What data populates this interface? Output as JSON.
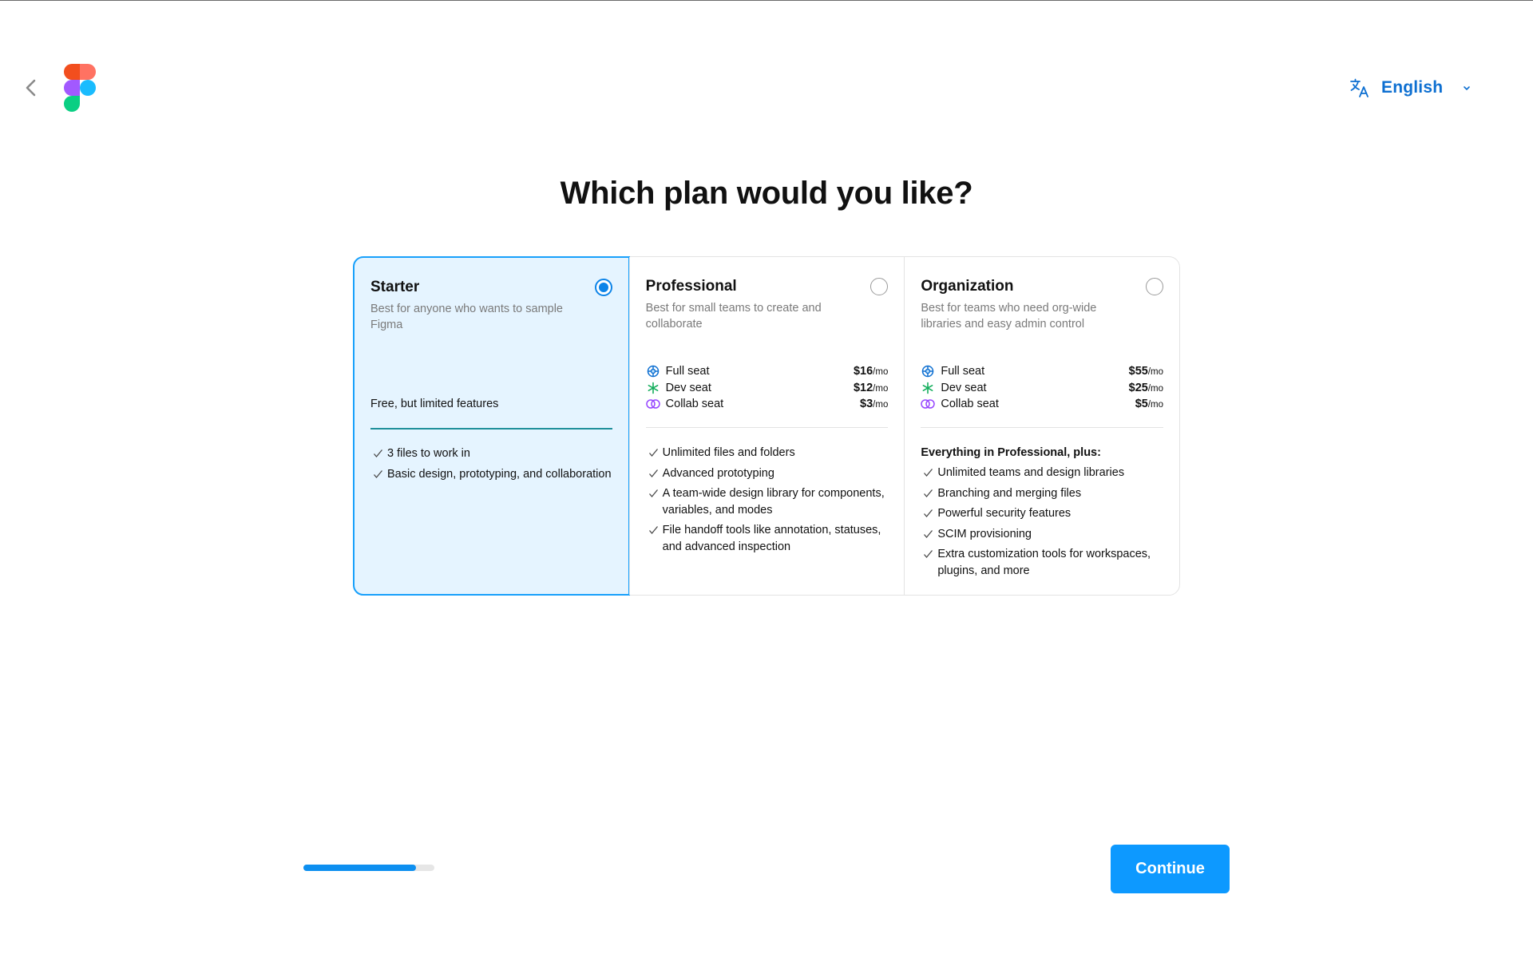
{
  "header": {
    "back_icon": "chevron-left-icon",
    "logo": "figma-logo",
    "language": {
      "icon": "translate-icon",
      "label": "English",
      "caret_icon": "chevron-down-icon"
    }
  },
  "title": "Which plan would you like?",
  "colors": {
    "accent": "#0d99ff",
    "selected_bg": "#e5f4ff",
    "link_blue": "#0d6fd1"
  },
  "plans": [
    {
      "name": "Starter",
      "description": "Best for anyone who wants to sample Figma",
      "selected": true,
      "note": "Free, but limited features",
      "features": [
        "3 files to work in",
        "Basic design, prototyping, and collaboration"
      ]
    },
    {
      "name": "Professional",
      "description": "Best for small teams to create and collaborate",
      "selected": false,
      "seats": [
        {
          "icon": "full-seat-icon",
          "name": "Full seat",
          "price": "$16",
          "per": "/mo"
        },
        {
          "icon": "dev-seat-icon",
          "name": "Dev seat",
          "price": "$12",
          "per": "/mo"
        },
        {
          "icon": "collab-seat-icon",
          "name": "Collab seat",
          "price": "$3",
          "per": "/mo"
        }
      ],
      "features": [
        "Unlimited files and folders",
        "Advanced prototyping",
        "A team-wide design library for components, variables, and modes",
        "File handoff tools like annotation, statuses, and advanced inspection"
      ]
    },
    {
      "name": "Organization",
      "description": "Best for teams who need org-wide libraries and easy admin control",
      "selected": false,
      "seats": [
        {
          "icon": "full-seat-icon",
          "name": "Full seat",
          "price": "$55",
          "per": "/mo"
        },
        {
          "icon": "dev-seat-icon",
          "name": "Dev seat",
          "price": "$25",
          "per": "/mo"
        },
        {
          "icon": "collab-seat-icon",
          "name": "Collab seat",
          "price": "$5",
          "per": "/mo"
        }
      ],
      "features_intro": "Everything in Professional, plus:",
      "features": [
        "Unlimited teams and design libraries",
        "Branching and merging files",
        "Powerful security features",
        "SCIM provisioning",
        "Extra customization tools for workspaces, plugins, and more"
      ]
    }
  ],
  "progress": {
    "fraction": 0.86
  },
  "continue_label": "Continue"
}
